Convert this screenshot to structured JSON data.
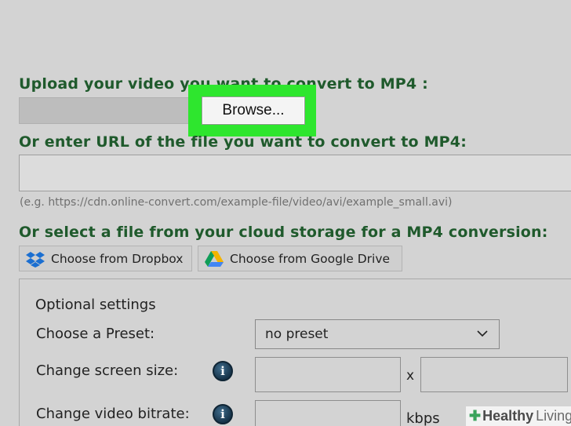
{
  "upload": {
    "heading": "Upload your video you want to convert to MP4 :",
    "browse_label": "Browse..."
  },
  "url": {
    "heading": "Or enter URL of the file you want to convert to MP4:",
    "value": "",
    "hint": "(e.g. https://cdn.online-convert.com/example-file/video/avi/example_small.avi)"
  },
  "cloud": {
    "heading": "Or select a file from your cloud storage for a MP4 conversion:",
    "dropbox_label": "Choose from Dropbox",
    "dropbox_icon": "dropbox-icon",
    "gdrive_label": "Choose from Google Drive",
    "gdrive_icon": "google-drive-icon"
  },
  "settings": {
    "title": "Optional settings",
    "preset_label": "Choose a Preset:",
    "preset_value": "no preset",
    "screen_size_label": "Change screen size:",
    "size_separator": "x",
    "bitrate_label": "Change video bitrate:",
    "bitrate_unit": "kbps",
    "info_icon_glyph": "i"
  },
  "watermark": {
    "word1": "Healthy",
    "word2": "Living"
  },
  "colors": {
    "heading_green": "#1f5a2c",
    "highlight": "#2ee62e",
    "background": "#d3d3d3"
  }
}
